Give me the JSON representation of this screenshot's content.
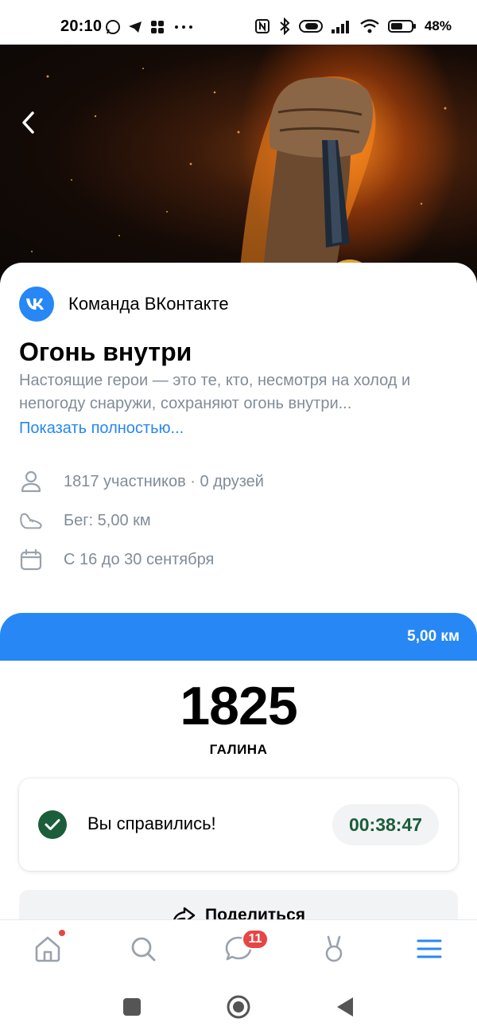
{
  "status_bar": {
    "time": "20:10",
    "battery": "48%"
  },
  "hero": {
    "back_icon": "chevron-left-icon"
  },
  "info": {
    "author": "Команда ВКонтакте",
    "title": "Огонь внутри",
    "description": "Настоящие герои — это те, кто, несмотря на холод и непогоду снаружи, сохраняют огонь внутри...",
    "show_more": "Показать полностью...",
    "participants": "1817 участников · 0 друзей",
    "activity": "Бег: 5,00 км",
    "dates": "С 16 до 30 сентября"
  },
  "result": {
    "distance": "5,00 км",
    "place": "1825",
    "runner_name": "ГАЛИНА",
    "done_text": "Вы справились!",
    "time": "00:38:47",
    "share_label": "Поделиться"
  },
  "tab_bar": {
    "messages_badge": "11"
  },
  "colors": {
    "accent": "#2787f5",
    "success": "#1a5e3a",
    "secondary_text": "#818c99",
    "badge": "#e64646"
  }
}
